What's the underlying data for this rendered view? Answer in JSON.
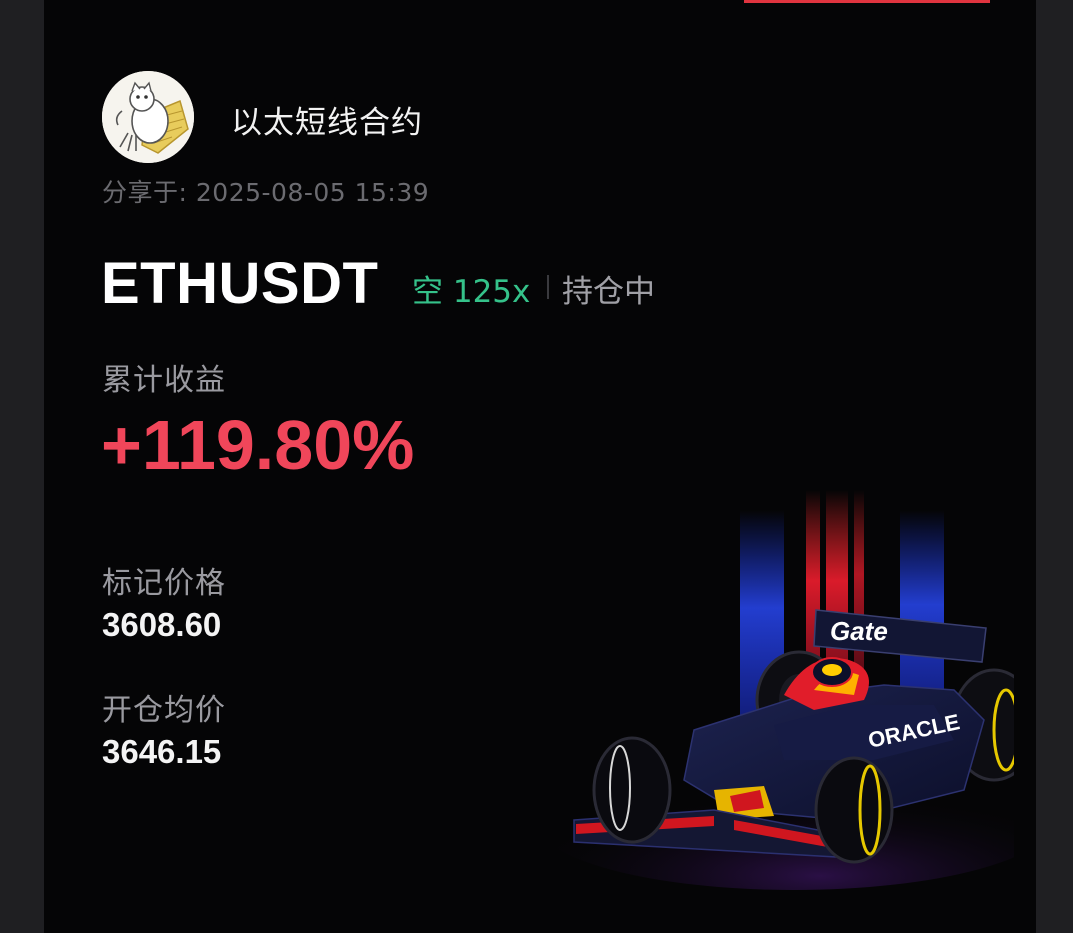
{
  "user": {
    "name": "以太短线合约"
  },
  "share": {
    "label": "分享于:",
    "datetime": "2025-08-05 15:39"
  },
  "position": {
    "symbol": "ETHUSDT",
    "direction_leverage": "空 125x",
    "status": "持仓中"
  },
  "pnl": {
    "label": "累计收益",
    "value": "+119.80%"
  },
  "mark_price": {
    "label": "标记价格",
    "value": "3608.60"
  },
  "entry_price": {
    "label": "开仓均价",
    "value": "3646.15"
  },
  "promo": {
    "wing_text": "Gate",
    "sidepod_text": "ORACLE"
  },
  "colors": {
    "background": "#050506",
    "profit": "#f0465a",
    "short": "#35c28a",
    "accent": "#e0343f"
  }
}
